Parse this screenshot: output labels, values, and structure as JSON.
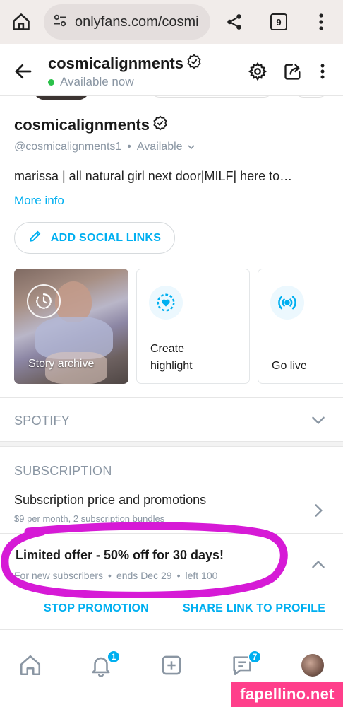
{
  "browser": {
    "url": "onlyfans.com/cosmi",
    "tab_count": "9"
  },
  "header": {
    "name": "cosmicalignments",
    "status": "Available now"
  },
  "profile": {
    "name": "cosmicalignments",
    "handle": "@cosmicalignments1",
    "separator": "•",
    "availability": "Available",
    "bio": "marissa | all natural girl next door|MILF| here to…",
    "more_info": "More info",
    "add_social_links": "ADD SOCIAL LINKS"
  },
  "cards": {
    "story_archive": "Story archive",
    "create_highlight_line1": "Create",
    "create_highlight_line2": "highlight",
    "go_live": "Go live"
  },
  "sections": {
    "spotify": "SPOTIFY",
    "subscription": "SUBSCRIPTION"
  },
  "subscription": {
    "price_title": "Subscription price and promotions",
    "price_subtitle": "$9 per month, 2 subscription bundles",
    "offer_title": "Limited offer - 50% off for 30 days!",
    "offer_audience": "For new subscribers",
    "offer_dot": "•",
    "offer_ends": "ends Dec 29",
    "offer_left": "left 100",
    "stop_promotion": "STOP PROMOTION",
    "share_link": "SHARE LINK TO PROFILE"
  },
  "nav": {
    "notifications_badge": "1",
    "messages_badge": "7"
  },
  "watermark": "fapellino.net",
  "colors": {
    "accent": "#00aff0",
    "highlight": "#d61ad6",
    "online": "#2bc14a",
    "watermark": "#ff3f8b"
  },
  "icons": [
    "home-icon",
    "tune-icon",
    "share-icon",
    "tabs-icon",
    "menu-dots-icon",
    "back-arrow-icon",
    "verified-icon",
    "settings-icon",
    "share-profile-icon",
    "pencil-icon",
    "clock-icon",
    "heart-ring-icon",
    "broadcast-icon",
    "chevron-down-icon",
    "chevron-right-icon",
    "chevron-up-icon",
    "bell-icon",
    "plus-square-icon",
    "chat-icon"
  ]
}
